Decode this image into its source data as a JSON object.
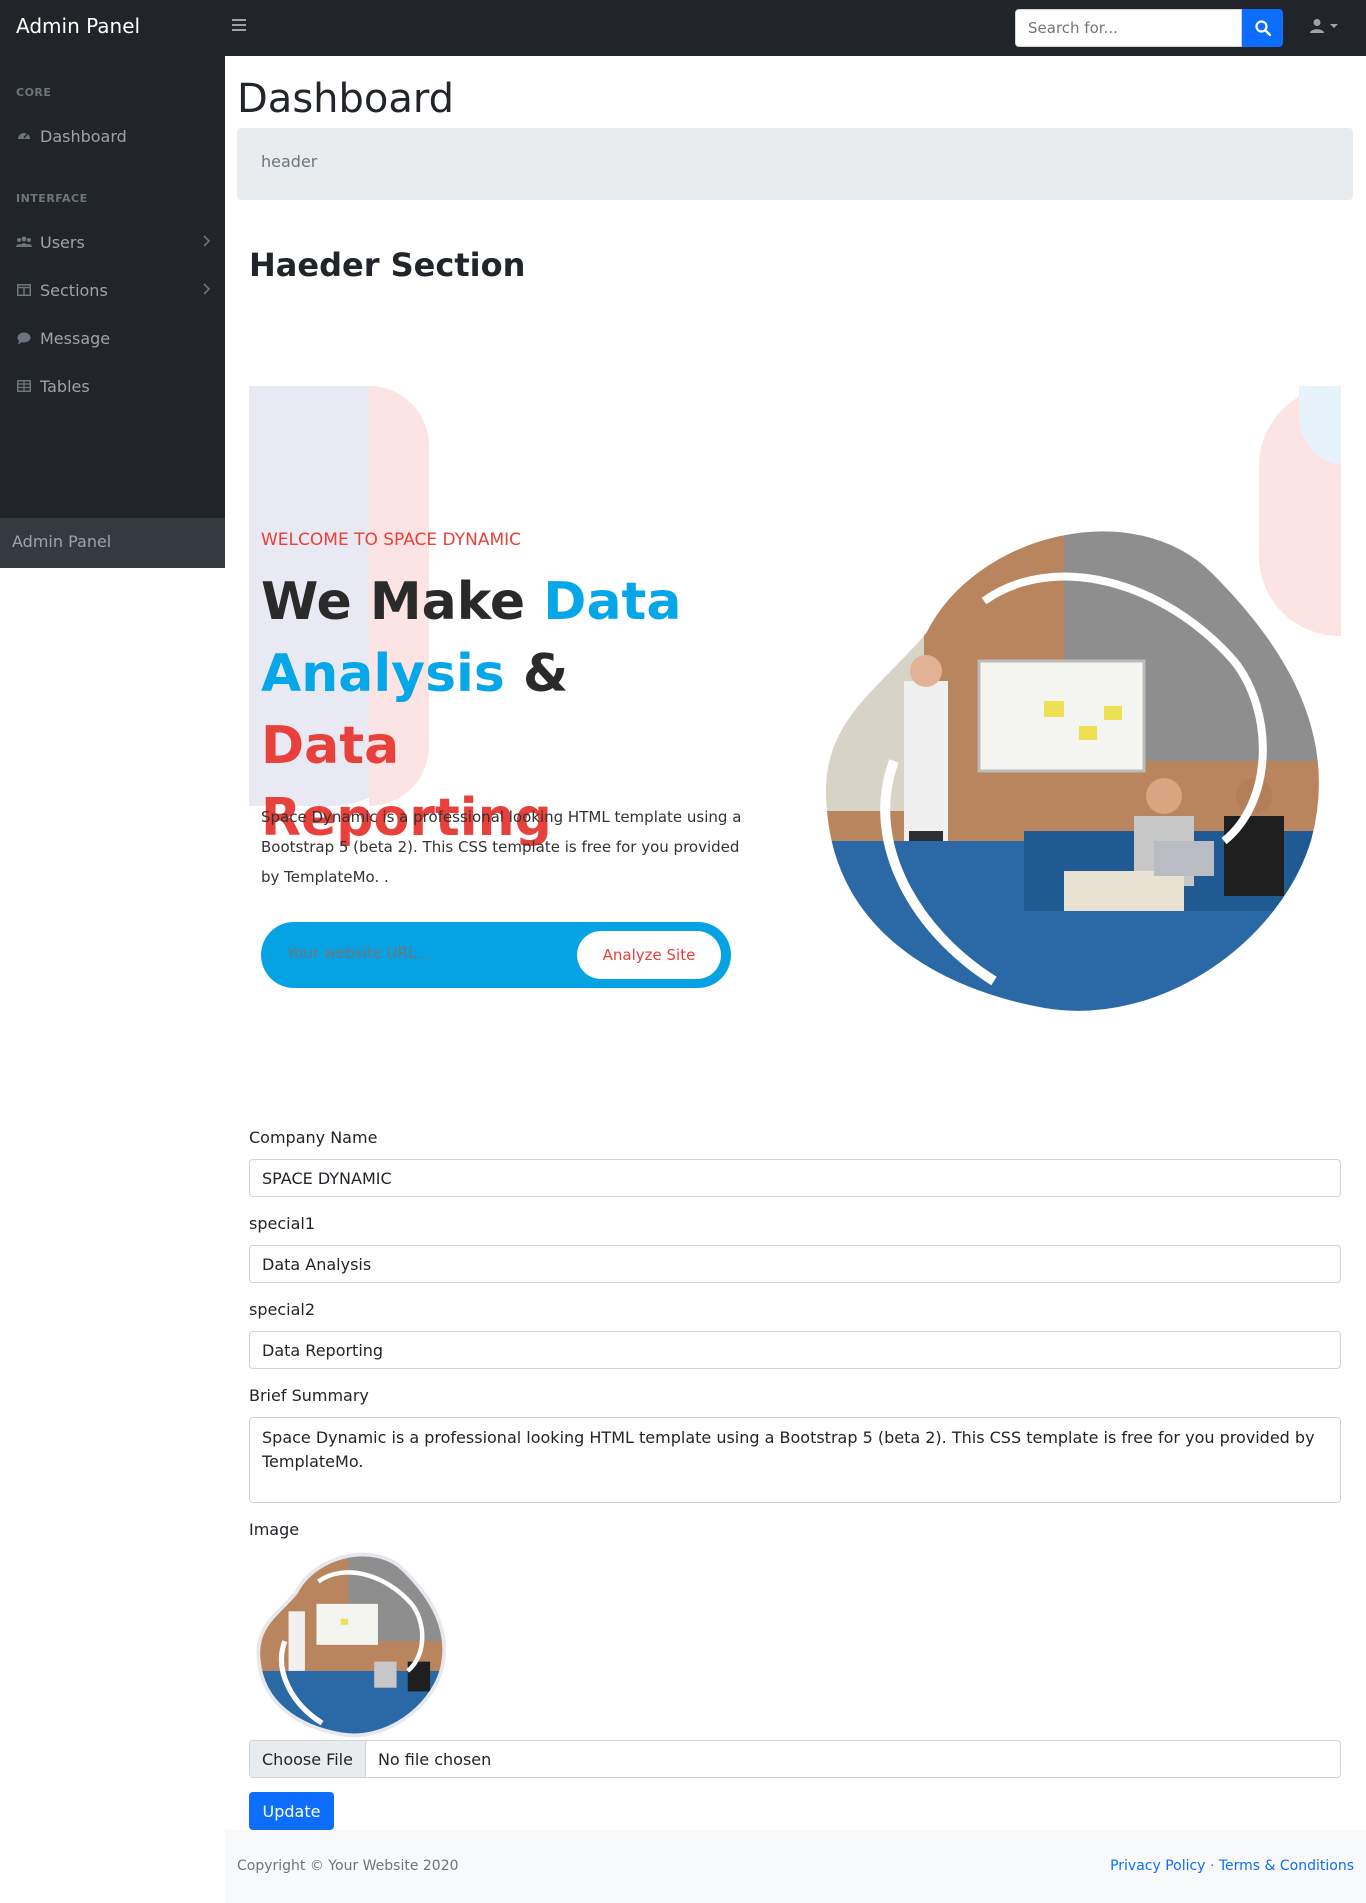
{
  "navbar": {
    "brand": "Admin Panel",
    "search_placeholder": "Search for..."
  },
  "sidebar": {
    "headings": [
      "CORE",
      "INTERFACE"
    ],
    "items": [
      {
        "label": "Dashboard",
        "icon": "tachometer-icon"
      },
      {
        "label": "Users",
        "icon": "users-icon"
      },
      {
        "label": "Sections",
        "icon": "columns-icon"
      },
      {
        "label": "Message",
        "icon": "comment-icon"
      },
      {
        "label": "Tables",
        "icon": "table-icon"
      }
    ],
    "footer": "Admin Panel"
  },
  "main": {
    "title": "Dashboard",
    "breadcrumb": "header",
    "section_title": "Haeder Section"
  },
  "hero": {
    "welcome": "WELCOME TO SPACE DYNAMIC",
    "headline": {
      "w1": "We",
      "w2": "Make",
      "w3": "Data",
      "w4": "Analysis",
      "w5": "&",
      "w6": "Data",
      "w7": "Reporting"
    },
    "description": "Space Dynamic is a professional looking HTML template using a Bootstrap 5 (beta 2). This CSS template is free for you provided by TemplateMo. .",
    "url_placeholder": "Your website URL...",
    "analyze_label": "Analyze Site"
  },
  "form": {
    "company_label": "Company Name",
    "company_value": "SPACE DYNAMIC",
    "special1_label": "special1",
    "special1_value": "Data Analysis",
    "special2_label": "special2",
    "special2_value": "Data Reporting",
    "summary_label": "Brief Summary",
    "summary_value": "Space Dynamic is a professional looking HTML template using a Bootstrap 5 (beta 2). This CSS template is free for you provided by TemplateMo.",
    "image_label": "Image",
    "file_button": "Choose File",
    "file_status": "No file chosen",
    "update_label": "Update"
  },
  "footer": {
    "copyright": "Copyright © Your Website 2020",
    "privacy": "Privacy Policy",
    "separator": "·",
    "terms": "Terms & Conditions"
  },
  "colors": {
    "nav_bg": "#212529",
    "primary": "#0d6efd",
    "hero_blue": "#06a7e8",
    "hero_red": "#e8403a"
  }
}
